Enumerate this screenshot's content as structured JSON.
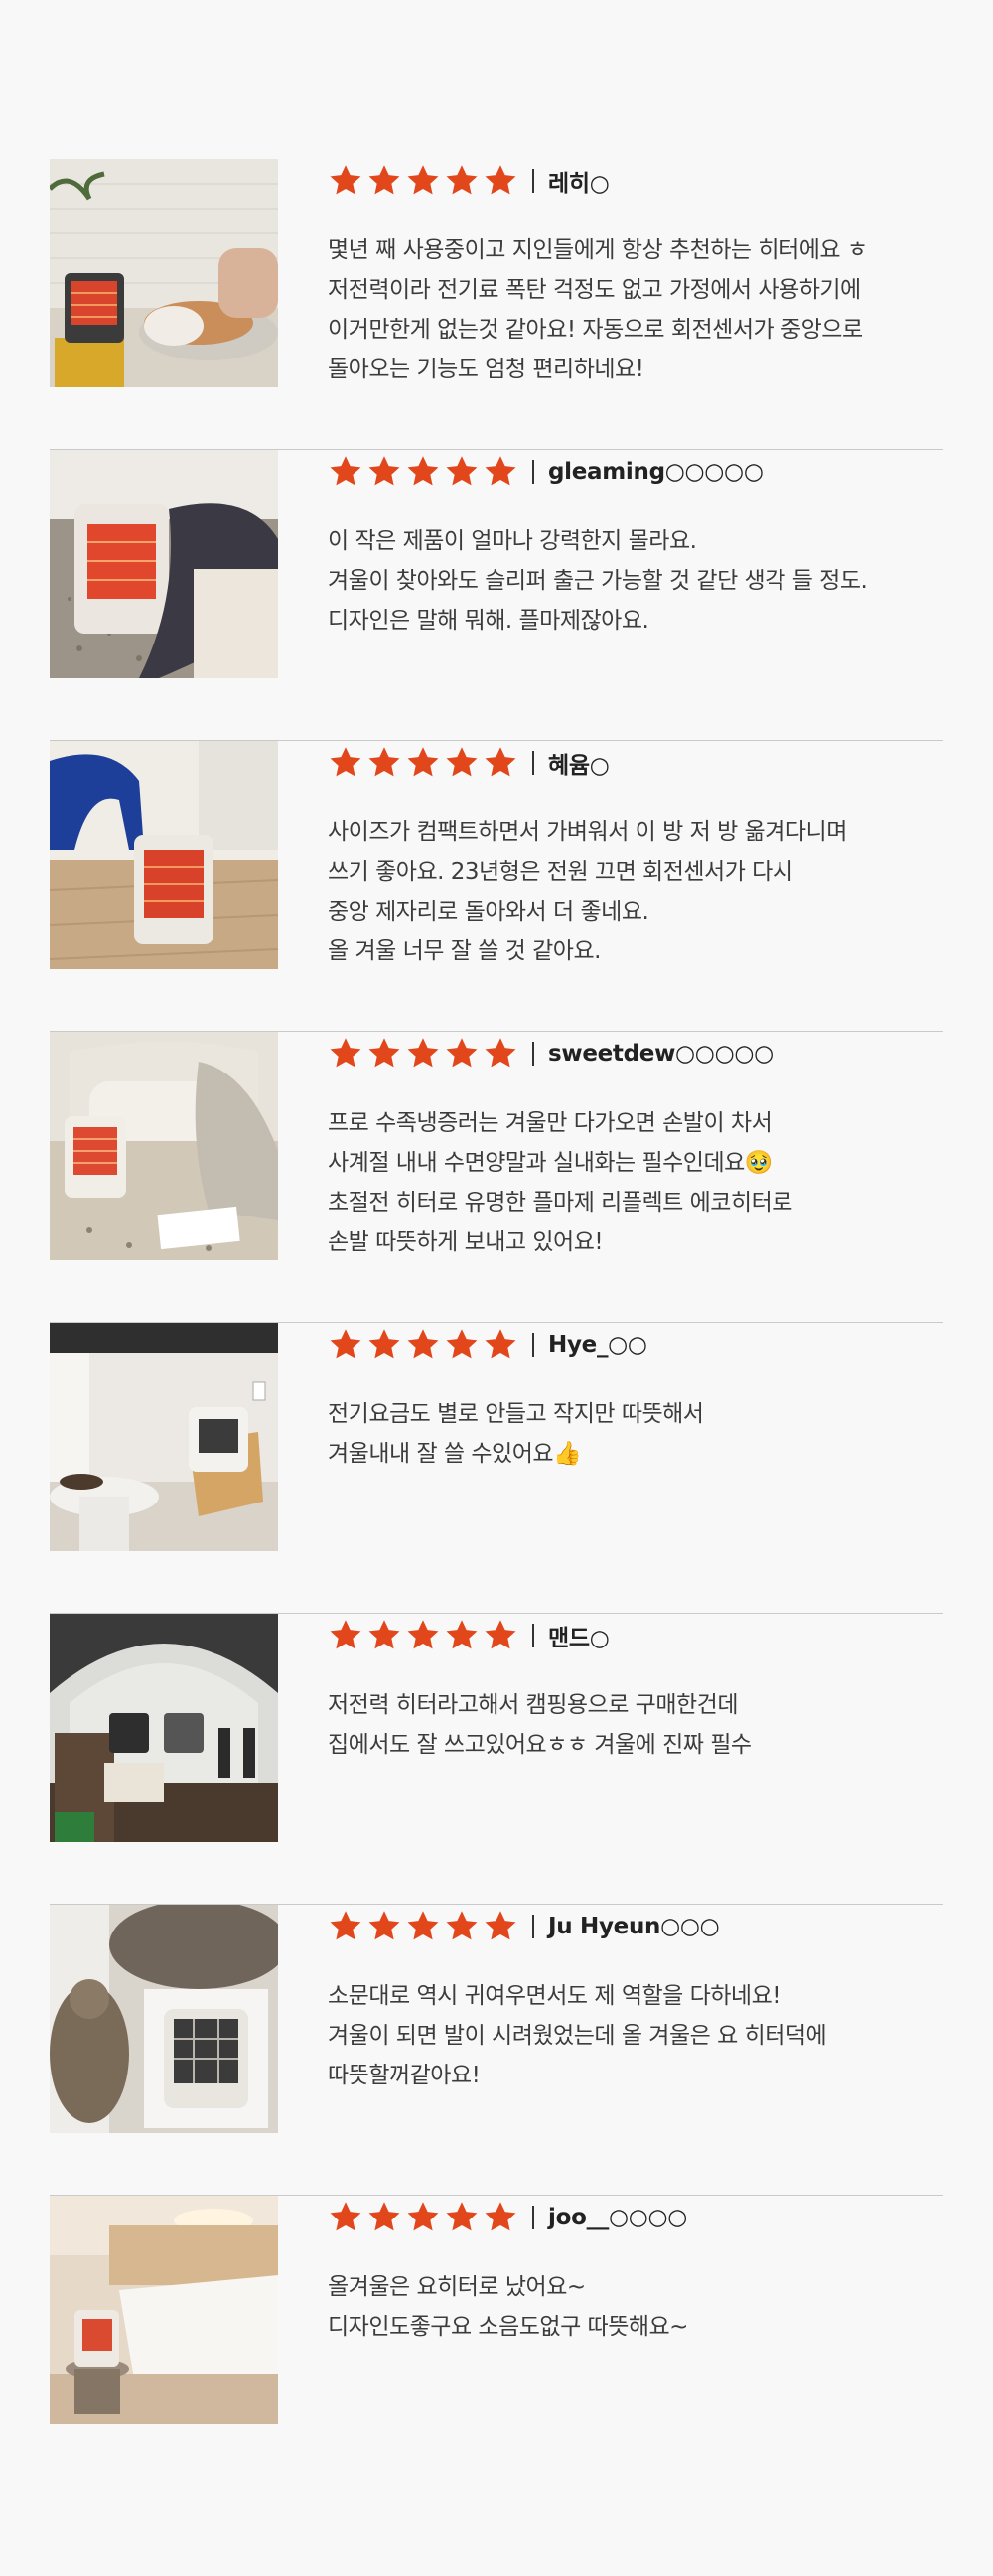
{
  "reviews": [
    {
      "reviewer": "레히○",
      "rating": 5,
      "photo": "heater-beside-sleeping-cat-icon",
      "lines": [
        "몇년 째 사용중이고 지인들에게 항상 추천하는 히터에요 ㅎ",
        "저전력이라 전기료 폭탄 걱정도 없고 가정에서 사용하기에",
        "이거만한게 없는것 같아요! 자동으로 회전센서가 중앙으로",
        "돌아오는 기능도 엄청 편리하네요!"
      ]
    },
    {
      "reviewer": "gleaming○○○○○",
      "rating": 5,
      "photo": "heater-on-floor-icon",
      "lines": [
        "이 작은 제품이 얼마나 강력한지 몰라요.",
        "겨울이 찾아와도 슬리퍼 출근 가능할 것 같단 생각 들 정도.",
        "디자인은 말해 뭐해. 플마제잖아요."
      ]
    },
    {
      "reviewer": "혜윰○",
      "rating": 5,
      "photo": "heater-beside-blue-chair-icon",
      "lines": [
        "사이즈가 컴팩트하면서 가벼워서 이 방 저 방 옮겨다니며",
        "쓰기 좋아요. 23년형은 전원 끄면 회전센서가 다시",
        "중앙 제자리로 돌아와서 더 좋네요.",
        "올 겨울 너무 잘 쓸 것 같아요."
      ]
    },
    {
      "reviewer": "sweetdew○○○○○",
      "rating": 5,
      "photo": "heater-in-living-room-icon",
      "lines": [
        "프로 수족냉증러는 겨울만 다가오면 손발이 차서",
        "사계절 내내 수면양말과 실내화는 필수인데요🥹",
        "초절전 히터로 유명한 플마제 리플렉트 에코히터로",
        "손발 따뜻하게 보내고 있어요!"
      ]
    },
    {
      "reviewer": "Hye_○○",
      "rating": 5,
      "photo": "heater-on-wooden-stand-icon",
      "lines": [
        "전기요금도 별로 안들고 작지만 따뜻해서",
        "겨울내내 잘 쓸 수있어요👍"
      ]
    },
    {
      "reviewer": "맨드○",
      "rating": 5,
      "photo": "heater-in-camping-tent-icon",
      "lines": [
        "저전력 히터라고해서 캠핑용으로 구매한건데",
        "집에서도 잘 쓰고있어요ㅎㅎ 겨울에 진짜 필수"
      ]
    },
    {
      "reviewer": "Ju Hyeun○○○",
      "rating": 5,
      "photo": "heater-box-with-cats-icon",
      "lines": [
        "소문대로 역시 귀여우면서도 제 역할을 다하네요!",
        "겨울이 되면 발이 시려웠었는데 올 겨울은 요 히터덕에",
        "따뜻할꺼같아요!"
      ]
    },
    {
      "reviewer": "joo__○○○○",
      "rating": 5,
      "photo": "heater-in-bedroom-icon",
      "lines": [
        "올겨울은 요히터로 났어요~",
        "디자인도좋구요 소음도없구 따뜻해요~"
      ]
    }
  ],
  "colors": {
    "star": "#e2471c",
    "background": "#f8f8f8",
    "divider": "#c9c9c9",
    "text": "#3c3c3c"
  }
}
